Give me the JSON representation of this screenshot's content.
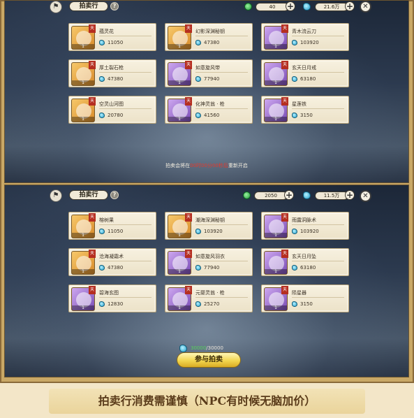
{
  "top": {
    "header": {
      "title": "拍卖行",
      "green_currency": "40",
      "blue_currency": "21.6万"
    },
    "items": [
      {
        "name": "蕴灵花",
        "price": "11050",
        "qty": "1",
        "rarity": "gold",
        "grade": "天"
      },
      {
        "name": "幻影深渊秘钥",
        "price": "47380",
        "qty": "1",
        "rarity": "gold",
        "grade": "天"
      },
      {
        "name": "青木流云刀",
        "price": "103920",
        "qty": "1",
        "rarity": "purple",
        "grade": "天"
      },
      {
        "name": "厚土裂石枪",
        "price": "47380",
        "qty": "1",
        "rarity": "gold",
        "grade": "天"
      },
      {
        "name": "如意旋风带",
        "price": "77940",
        "qty": "1",
        "rarity": "purple",
        "grade": "天"
      },
      {
        "name": "玄天日月戒",
        "price": "63180",
        "qty": "1",
        "rarity": "purple",
        "grade": "天"
      },
      {
        "name": "空灵山河图",
        "price": "20780",
        "qty": "1",
        "rarity": "gold",
        "grade": "天"
      },
      {
        "name": "化神灵翁 · 枪",
        "price": "41560",
        "qty": "1",
        "rarity": "purple",
        "grade": "天"
      },
      {
        "name": "星莲铁",
        "price": "3150",
        "qty": "1",
        "rarity": "purple",
        "grade": "天"
      }
    ],
    "notice_prefix": "拍卖会将在",
    "notice_highlight": "00时00分00秒后",
    "notice_suffix": "重新开启"
  },
  "bottom": {
    "header": {
      "title": "拍卖行",
      "green_currency": "2050",
      "blue_currency": "11.5万"
    },
    "items": [
      {
        "name": "榕树果",
        "price": "11050",
        "qty": "1",
        "rarity": "gold",
        "grade": "天"
      },
      {
        "name": "潮海深渊秘钥",
        "price": "103920",
        "qty": "1",
        "rarity": "gold",
        "grade": "天"
      },
      {
        "name": "雨露洞脉术",
        "price": "103920",
        "qty": "1",
        "rarity": "purple",
        "grade": "天"
      },
      {
        "name": "沧海凝霜术",
        "price": "47380",
        "qty": "1",
        "rarity": "gold",
        "grade": "天"
      },
      {
        "name": "如意旋风羽衣",
        "price": "77940",
        "qty": "1",
        "rarity": "purple",
        "grade": "天"
      },
      {
        "name": "玄天日月坠",
        "price": "63180",
        "qty": "1",
        "rarity": "purple",
        "grade": "天"
      },
      {
        "name": "碧海玄图",
        "price": "12830",
        "qty": "1",
        "rarity": "purple",
        "grade": "天"
      },
      {
        "name": "元婴灵翁 · 枪",
        "price": "25270",
        "qty": "1",
        "rarity": "purple",
        "grade": "天"
      },
      {
        "name": "陨星器",
        "price": "3150",
        "qty": "1",
        "rarity": "purple",
        "grade": "天"
      }
    ],
    "deposit_current": "30000",
    "deposit_total": "/30000",
    "join_label": "参与拍卖"
  },
  "caption": "拍卖行消费需谨慎（NPC有时候无脑加价）",
  "icons": {
    "logo": "guild-icon",
    "help": "?",
    "plus": "+",
    "close": "✕"
  }
}
